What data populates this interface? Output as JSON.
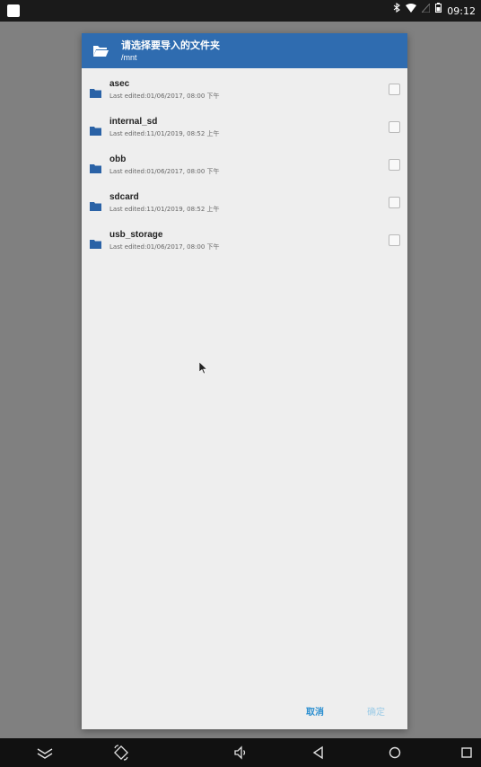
{
  "status_bar": {
    "time": "09:12",
    "icons": [
      "app-notification-icon",
      "bluetooth-icon",
      "wifi-icon",
      "signal-icon",
      "battery-icon"
    ]
  },
  "dialog": {
    "title": "请选择要导入的文件夹",
    "path": "/mnt",
    "items": [
      {
        "name": "asec",
        "meta": "Last edited:01/06/2017, 08:00 下午",
        "checked": false
      },
      {
        "name": "internal_sd",
        "meta": "Last edited:11/01/2019, 08:52 上午",
        "checked": false
      },
      {
        "name": "obb",
        "meta": "Last edited:01/06/2017, 08:00 下午",
        "checked": false
      },
      {
        "name": "sdcard",
        "meta": "Last edited:11/01/2019, 08:52 上午",
        "checked": false
      },
      {
        "name": "usb_storage",
        "meta": "Last edited:01/06/2017, 08:00 下午",
        "checked": false
      }
    ],
    "cancel_label": "取消",
    "ok_label": "确定"
  },
  "nav_bar": {
    "buttons": [
      "collapse-icon",
      "rotate-icon",
      "volume-icon",
      "back-icon",
      "home-icon",
      "recents-icon"
    ]
  },
  "colors": {
    "header": "#2f6cb0",
    "folder": "#2a62a6",
    "accent": "#2c8fd0",
    "dialog_bg": "#eeeeee"
  }
}
